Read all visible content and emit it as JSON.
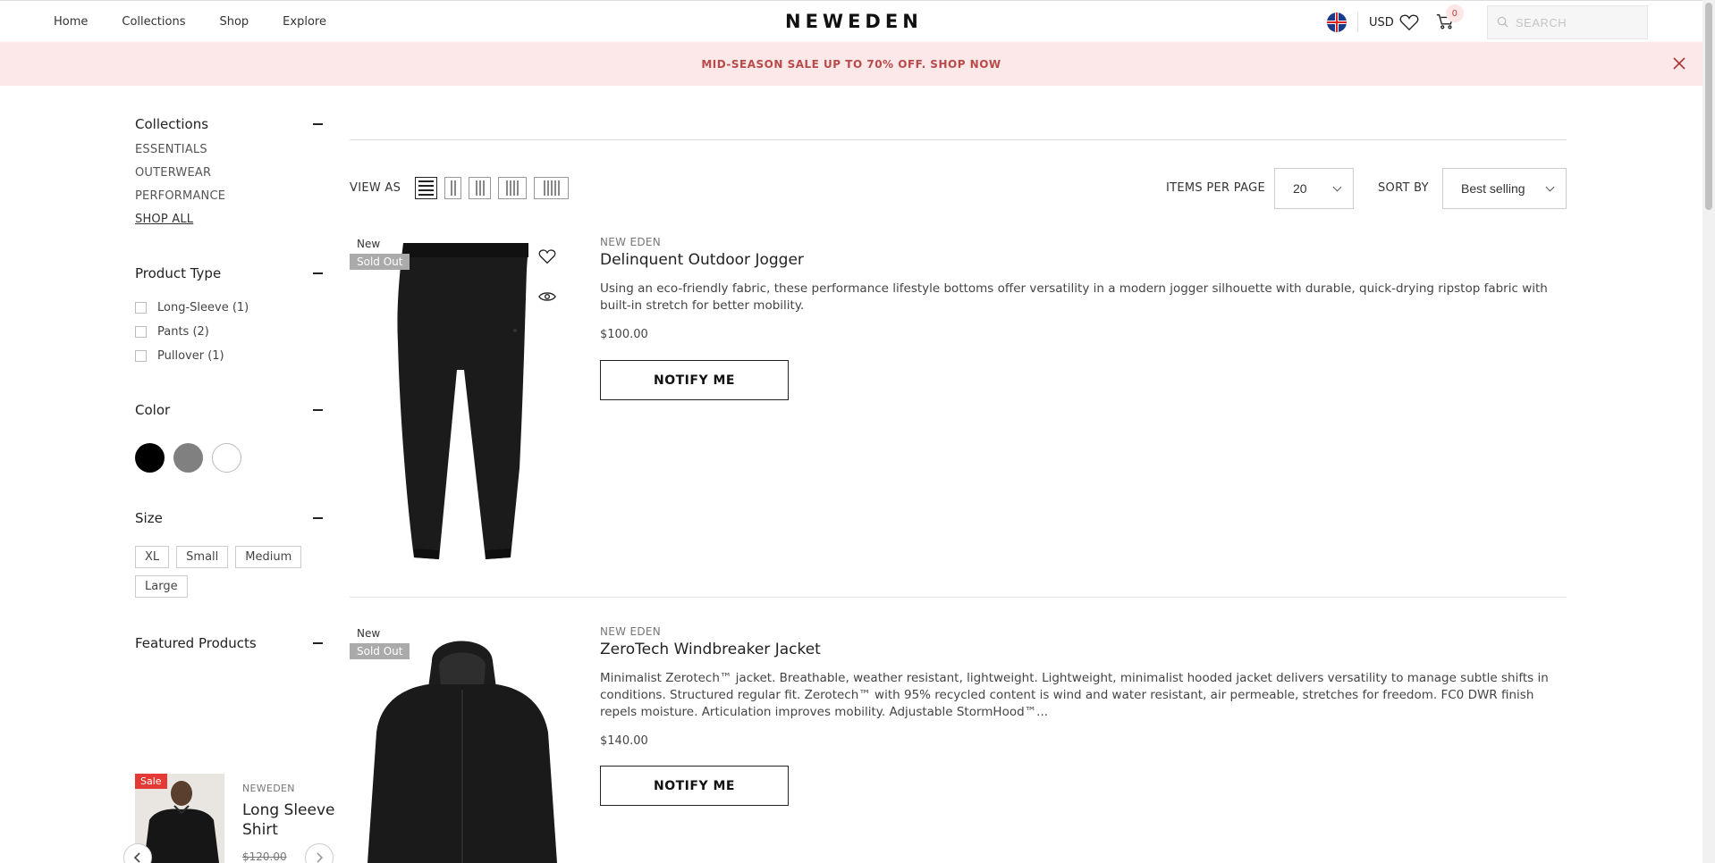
{
  "header": {
    "nav": [
      "Home",
      "Collections",
      "Shop",
      "Explore"
    ],
    "logo": "NEWEDEN",
    "currency": "USD",
    "cart_count": "0",
    "search_placeholder": "SEARCH",
    "icons": [
      "uk-flag-icon",
      "heart-icon",
      "cart-icon",
      "search-icon"
    ]
  },
  "banner": {
    "text": "MID-SEASON SALE UP TO 70% OFF. SHOP NOW",
    "bg_color": "#fce8e8",
    "text_color": "#b84a4a"
  },
  "sidebar": {
    "collections": {
      "title": "Collections",
      "items": [
        "ESSENTIALS",
        "OUTERWEAR",
        "PERFORMANCE",
        "SHOP ALL"
      ]
    },
    "product_type": {
      "title": "Product Type",
      "items": [
        "Long-Sleeve (1)",
        "Pants (2)",
        "Pullover (1)"
      ]
    },
    "color": {
      "title": "Color",
      "swatches": [
        "#000000",
        "#808080",
        "#ffffff"
      ]
    },
    "size": {
      "title": "Size",
      "items": [
        "XL",
        "Small",
        "Medium",
        "Large"
      ]
    },
    "featured": {
      "title": "Featured Products",
      "badge": "Sale",
      "brand": "NEWEDEN",
      "name": "Long Sleeve Shirt",
      "price": "$120.00"
    }
  },
  "toolbar": {
    "view_as": "VIEW AS",
    "items_per_page_label": "ITEMS PER PAGE",
    "items_per_page_value": "20",
    "sort_by_label": "SORT BY",
    "sort_by_value": "Best selling"
  },
  "products": [
    {
      "badge_new": "New",
      "badge_status": "Sold Out",
      "brand": "NEW EDEN",
      "name": "Delinquent Outdoor Jogger",
      "description": "Using an eco-friendly fabric, these performance lifestyle bottoms offer versatility in a modern jogger silhouette with durable, quick-drying ripstop fabric with built-in stretch for better mobility.",
      "price": "$100.00",
      "button": "NOTIFY ME"
    },
    {
      "badge_new": "New",
      "badge_status": "Sold Out",
      "brand": "NEW EDEN",
      "name": "ZeroTech Windbreaker Jacket",
      "description": "Minimalist Zerotech™  jacket. Breathable, weather resistant, lightweight. Lightweight, minimalist hooded jacket delivers versatility to manage subtle shifts in conditions. Structured regular fit. Zerotech™ with 95% recycled content is wind and water resistant, air permeable, stretches for freedom. FC0 DWR finish repels moisture. Articulation improves mobility. Adjustable StormHood™...",
      "price": "$140.00",
      "button": "NOTIFY ME"
    }
  ]
}
